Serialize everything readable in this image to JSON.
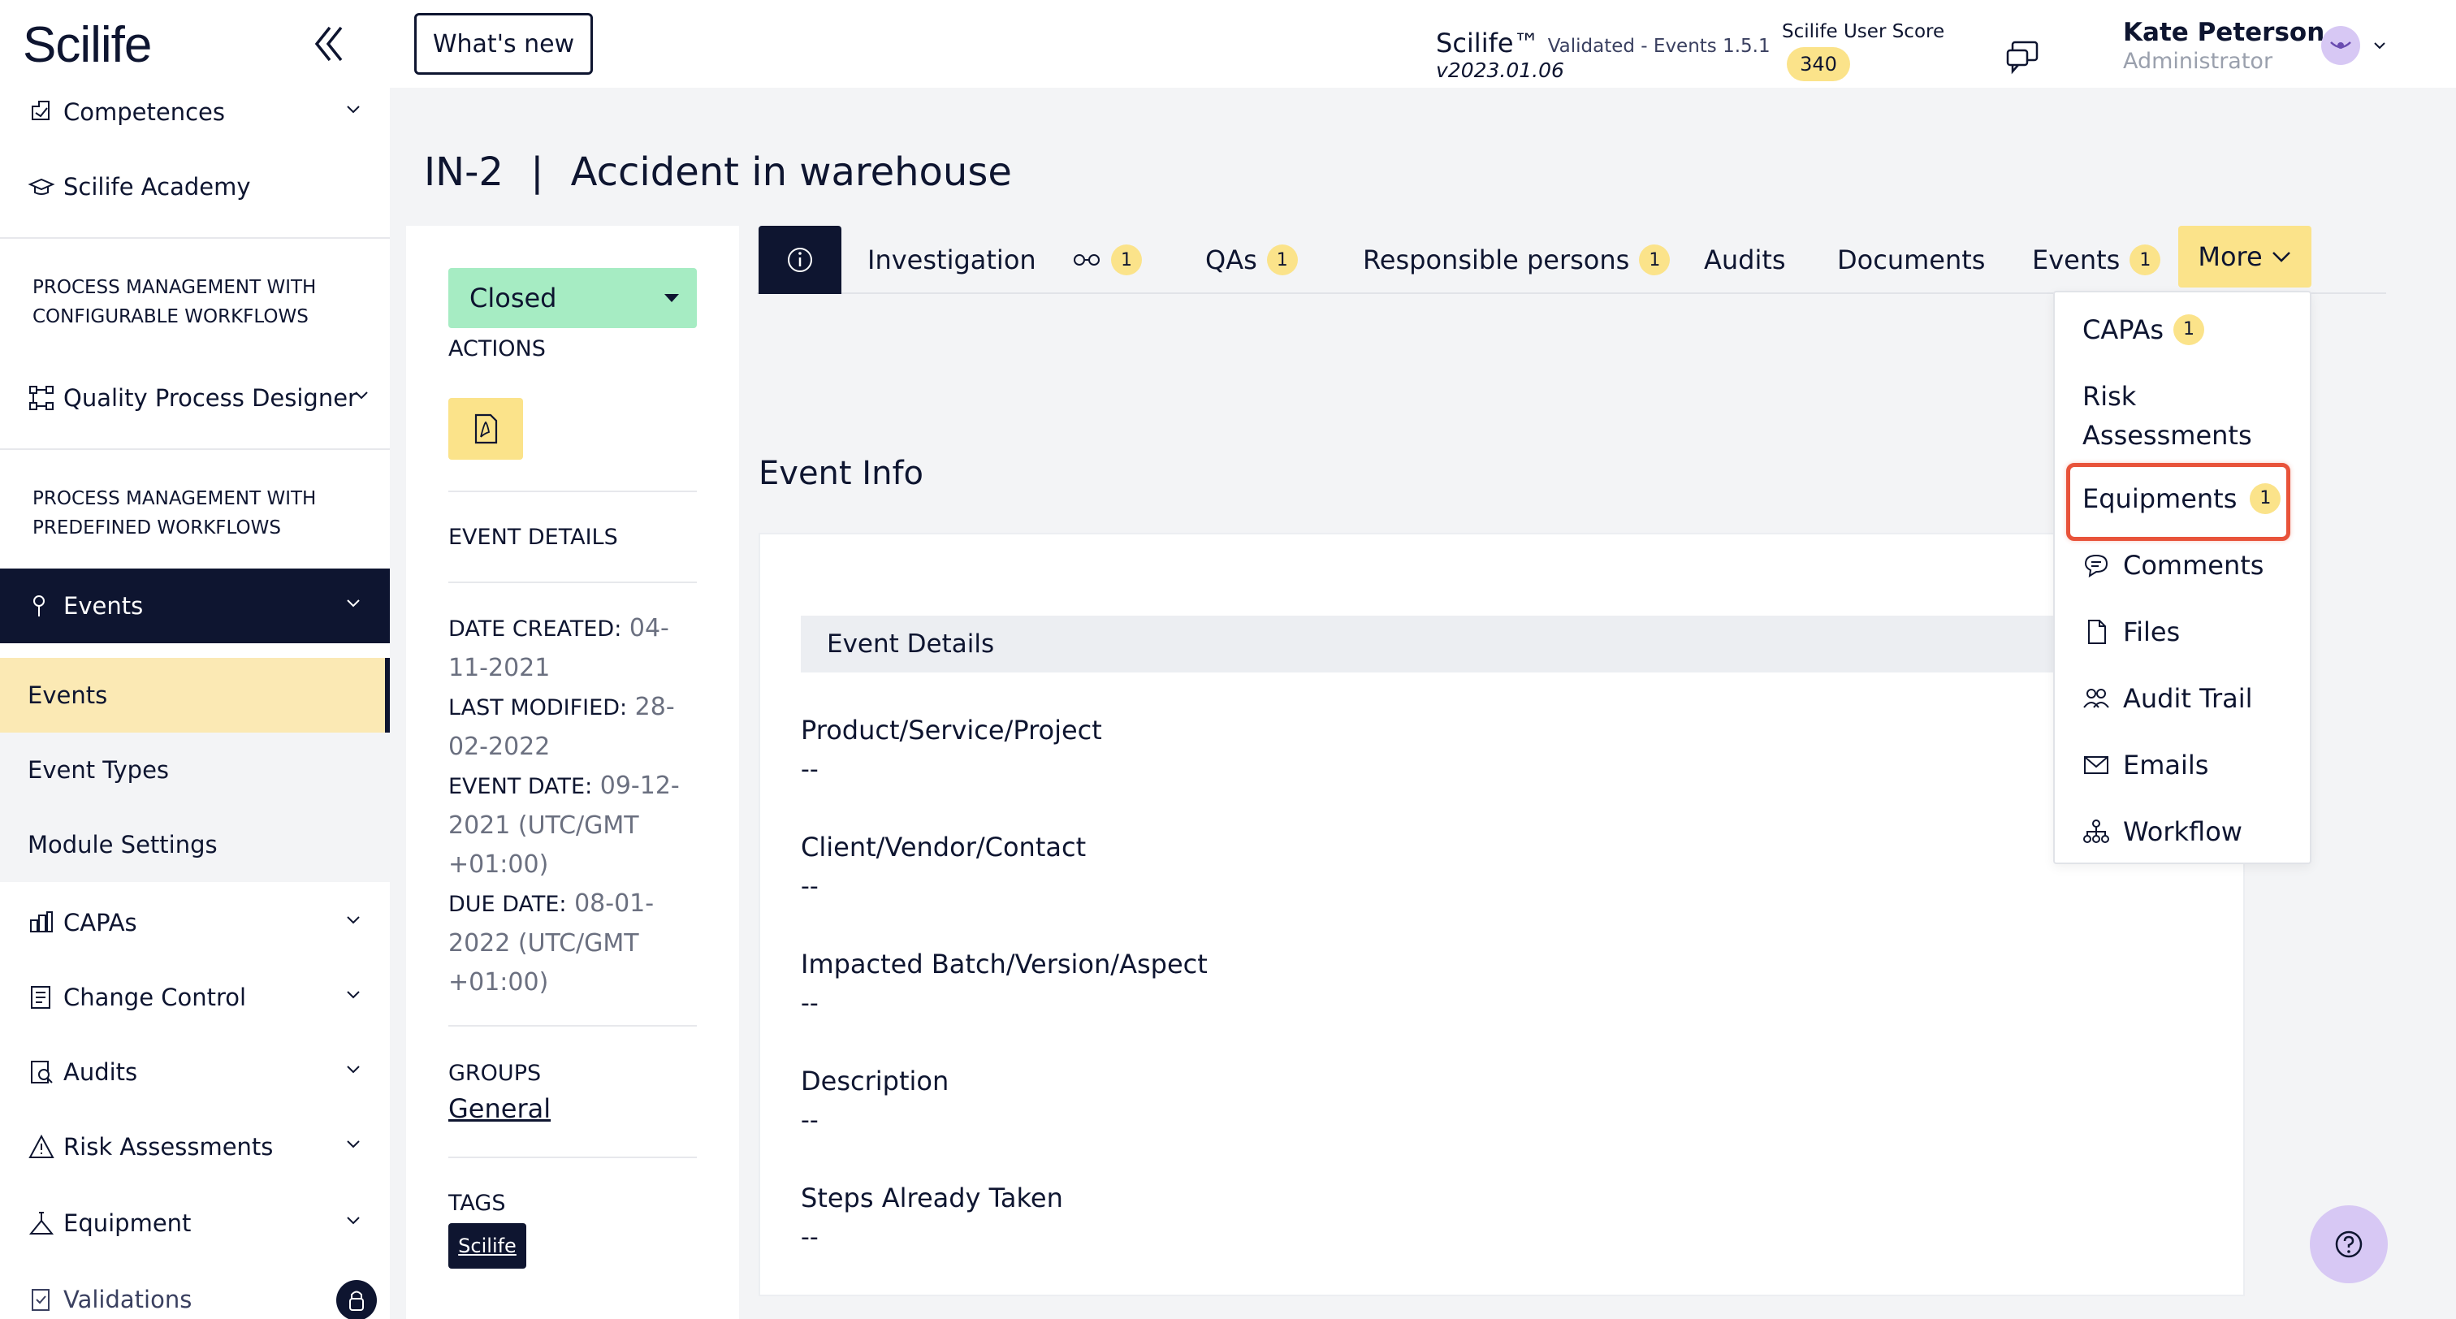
{
  "app": {
    "logo_text": "Scilife"
  },
  "sidebar": {
    "items": [
      {
        "label": "Competences"
      },
      {
        "label": "Scilife Academy"
      },
      {
        "label": "Quality Process Designer"
      },
      {
        "label": "Events"
      },
      {
        "label": "Events"
      },
      {
        "label": "Event Types"
      },
      {
        "label": "Module Settings"
      },
      {
        "label": "CAPAs"
      },
      {
        "label": "Change Control"
      },
      {
        "label": "Audits"
      },
      {
        "label": "Risk Assessments"
      },
      {
        "label": "Equipment"
      },
      {
        "label": "Validations"
      }
    ],
    "headings": [
      "PROCESS MANAGEMENT WITH CONFIGURABLE WORKFLOWS",
      "PROCESS MANAGEMENT WITH PREDEFINED WORKFLOWS"
    ]
  },
  "topbar": {
    "whats_new": "What's new",
    "product_name": "Scilife™",
    "product_validated": "Validated - Events 1.5.1",
    "version": "v2023.01.06",
    "score_label": "Scilife User Score",
    "score_value": "340",
    "user_name": "Kate Peterson",
    "user_role": "Administrator"
  },
  "page": {
    "id": "IN-2",
    "separator": "|",
    "title": "Accident in warehouse"
  },
  "left_panel": {
    "status": "Closed",
    "actions_label": "ACTIONS",
    "event_details_label": "EVENT DETAILS",
    "date_created_label": "DATE CREATED:",
    "date_created_value": "04-11-2021",
    "last_modified_label": "LAST MODIFIED:",
    "last_modified_value": "28-02-2022",
    "event_date_label": "EVENT DATE:",
    "event_date_value": "09-12-2021 (UTC/GMT +01:00)",
    "due_date_label": "DUE DATE:",
    "due_date_value": "08-01-2022 (UTC/GMT +01:00)",
    "groups_label": "GROUPS",
    "group_value": "General",
    "tags_label": "TAGS",
    "tag_value": "Scilife"
  },
  "tabs": [
    {
      "label": "Investigation"
    },
    {
      "label": "",
      "badge": "1"
    },
    {
      "label": "QAs",
      "badge": "1"
    },
    {
      "label": "Responsible persons",
      "badge": "1"
    },
    {
      "label": "Audits"
    },
    {
      "label": "Documents"
    },
    {
      "label": "Events",
      "badge": "1"
    }
  ],
  "more_label": "More",
  "more_menu": [
    {
      "label": "CAPAs",
      "badge": "1"
    },
    {
      "label": "Risk Assessments"
    },
    {
      "label": "Equipments",
      "badge": "1"
    },
    {
      "label": "Comments"
    },
    {
      "label": "Files"
    },
    {
      "label": "Audit Trail"
    },
    {
      "label": "Emails"
    },
    {
      "label": "Workflow"
    }
  ],
  "main": {
    "section_title": "Event Info",
    "card_header": "Event Details",
    "fields": [
      {
        "label": "Product/Service/Project",
        "value": "--"
      },
      {
        "label": "Client/Vendor/Contact",
        "value": "--"
      },
      {
        "label": "Impacted Batch/Version/Aspect",
        "value": "--"
      },
      {
        "label": "Description",
        "value": "--"
      },
      {
        "label": "Steps Already Taken",
        "value": "--"
      }
    ]
  },
  "colors": {
    "navy": "#0e1530",
    "accent_yellow": "#fbe38a",
    "status_green": "#a6ecc3",
    "highlight_red": "#e8533a",
    "help_purple": "#d7c8f4"
  },
  "icons": [
    "collapse-icon",
    "competences-icon",
    "academy-icon",
    "designer-icon",
    "events-icon",
    "capas-icon",
    "change-control-icon",
    "audits-icon",
    "risk-icon",
    "equipment-icon",
    "validations-icon",
    "lock-icon",
    "chat-icon",
    "avatar-icon",
    "info-icon",
    "glasses-icon",
    "pdf-icon",
    "comments-icon",
    "files-icon",
    "audit-trail-icon",
    "emails-icon",
    "workflow-icon",
    "help-icon"
  ]
}
